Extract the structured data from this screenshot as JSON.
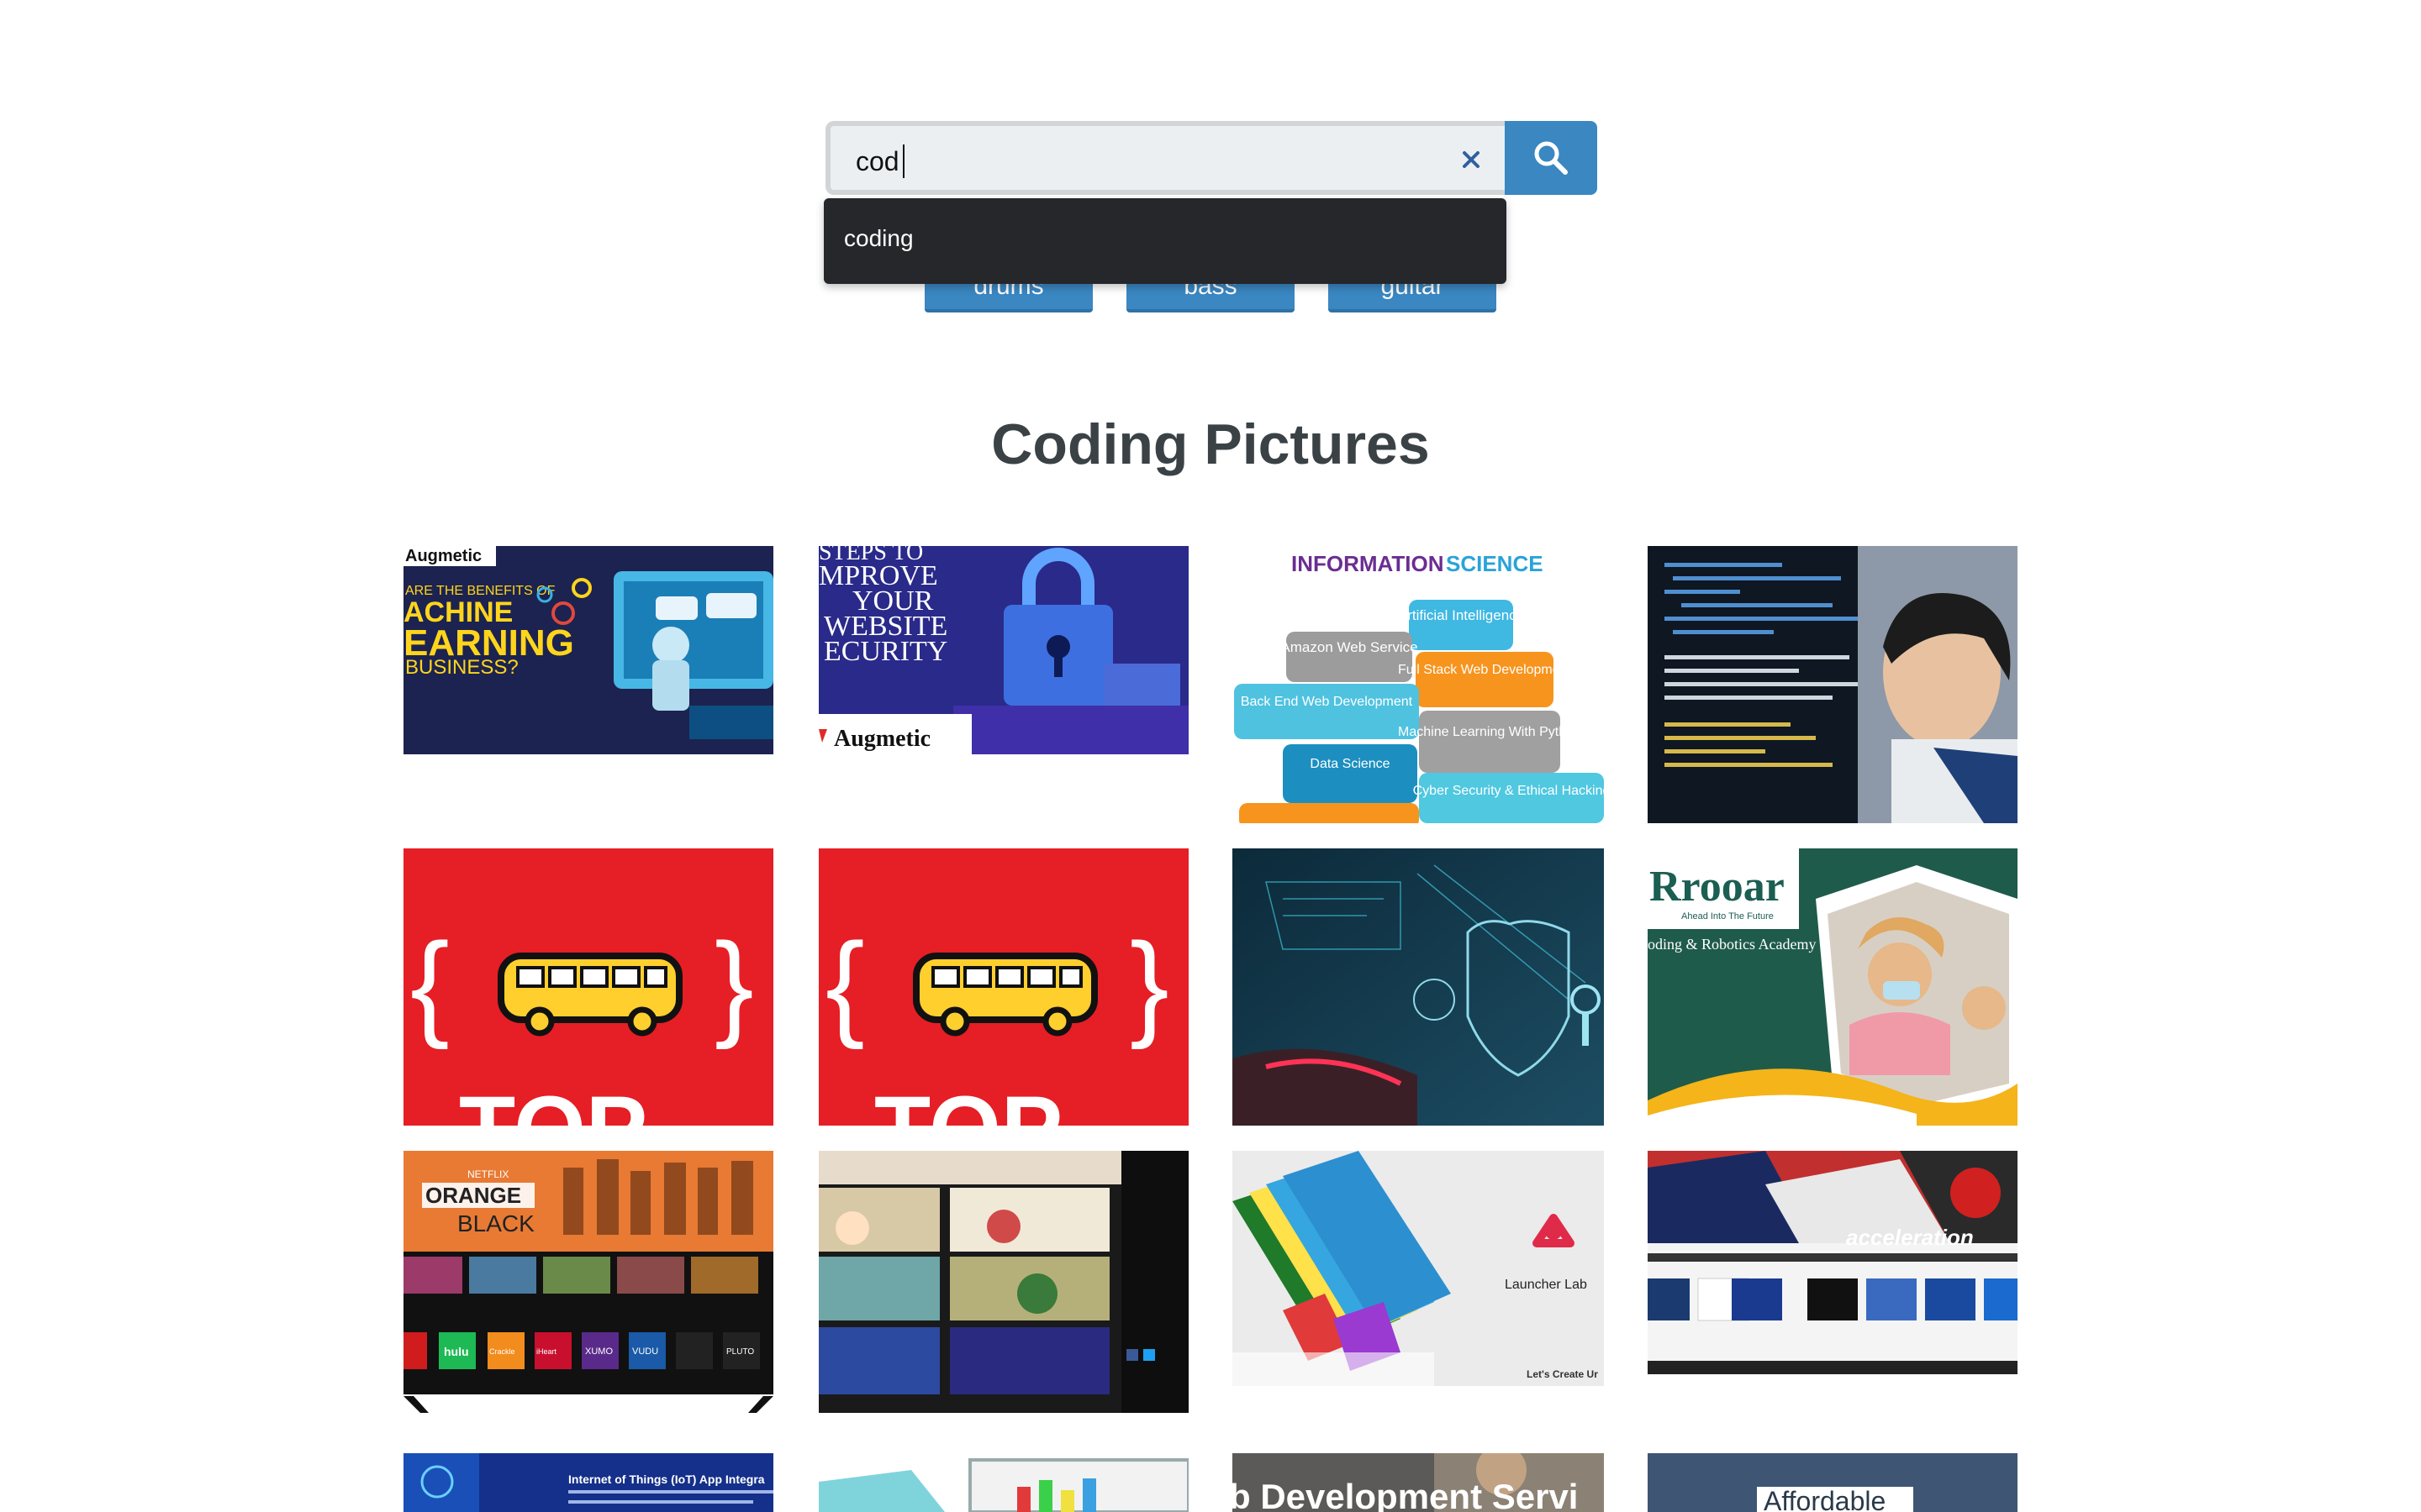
{
  "search": {
    "value": "cod",
    "clear_icon": "close-icon",
    "search_icon": "search-icon"
  },
  "tags": [
    "drums",
    "bass",
    "guitar"
  ],
  "suggestions": [
    "coding"
  ],
  "page_title": "Coding Pictures",
  "colors": {
    "accent": "#3a87c2",
    "dropdown_bg": "#26272b",
    "title": "#3b4246",
    "input_bg": "#eceff1"
  },
  "images": {
    "r1": {
      "ml_brand": "Augmetic",
      "ml_text": [
        "ARE THE BENEFITS OF",
        "ACHINE",
        "EARNING",
        "BUSINESS?"
      ],
      "sec_text": [
        "STEPS TO",
        "MPROVE",
        "YOUR",
        "WEBSITE",
        "ECURITY"
      ],
      "sec_brand": "Augmetic",
      "info_title_a": "INFORMATION",
      "info_title_b": "SCIENCE",
      "info_blocks": [
        "Artificial Intelligence",
        "Amazon Web Service",
        "Full Stack Web Development",
        "Back End Web Development",
        "Machine Learning With Python",
        "Data Science",
        "Cyber Security & Ethical Hacking"
      ]
    },
    "r2": {
      "bus_text": "TOP",
      "rooar_brand": "Rrooar",
      "rooar_tagline": "Ahead Into The Future",
      "rooar_sub": "oding & Robotics Academy"
    },
    "r3": {
      "tv_title_a": "ORANGE",
      "tv_title_b": "BLACK",
      "tv_netflix": "NETFLIX",
      "tv_apps": [
        "hulu",
        "Crackle",
        "iHeart",
        "XUMO",
        "VUDU",
        "PLUTO"
      ],
      "launcher_name": "Launcher Lab",
      "launcher_tag": "Let's Create Ur",
      "accel_title": "acceleration"
    },
    "r4": {
      "iot_title": "Internet of Things (IoT) App Integra",
      "web_title": "b Development Servi",
      "afford_title": "Affordable"
    }
  }
}
